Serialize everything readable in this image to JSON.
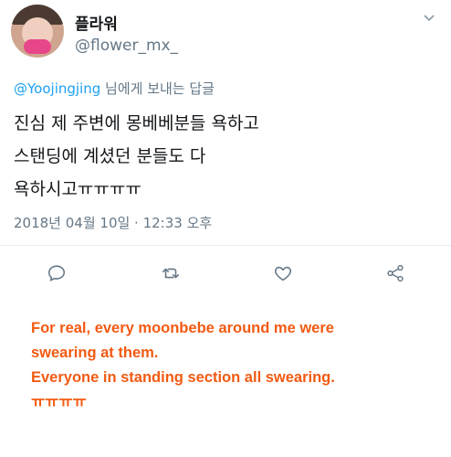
{
  "tweet": {
    "display_name": "플라워",
    "handle": "@flower_mx_",
    "reply_mention": "@Yoojingjing",
    "reply_suffix": " 님에게 보내는 답글",
    "body": "진심 제 주변에 몽베베분들 욕하고\n스탠딩에 계셨던 분들도 다\n욕하시고ㅠㅠㅠㅠ",
    "timestamp": "2018년 04월 10일 · 12:33 오후",
    "actions": [
      "reply-icon",
      "retweet-icon",
      "like-icon",
      "share-icon"
    ]
  },
  "translation": {
    "line1": "For real, every moonbebe around me were",
    "line2": "swearing at them.",
    "line3": "Everyone in standing section all swearing.",
    "line4": "ㅠㅠㅠㅠ"
  },
  "colors": {
    "link": "#1da1f2",
    "muted": "#657786",
    "translation": "#f25a12"
  }
}
